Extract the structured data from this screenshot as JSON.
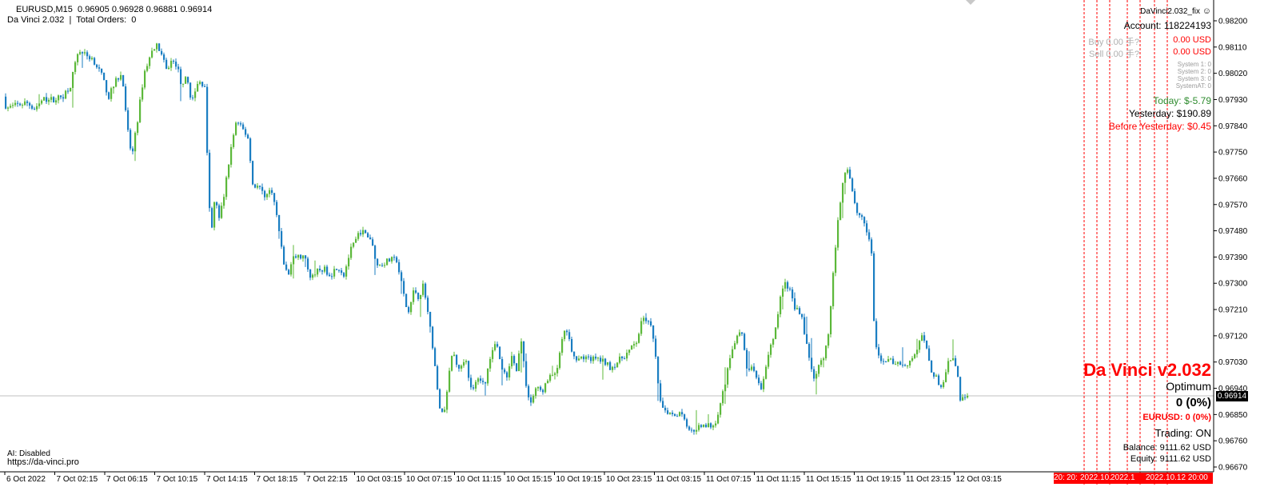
{
  "header": {
    "symbol_line": "EURUSD,M15  0.96905 0.96928 0.96881 0.96914",
    "ea_line": "Da Vinci 2.032  |  Total Orders:  0"
  },
  "footer_left": {
    "ai_status": "AI: Disabled",
    "website": "https://da-vinci.pro"
  },
  "overlay": {
    "ea_file": "DaVinci2.032_fix",
    "account": "Account: 118224193",
    "buy_label": "Buy 0.00 手?",
    "buy_value": "0.00 USD",
    "sell_label": "Sell 0.00 手?",
    "sell_value": "0.00 USD",
    "systems": [
      "System 1: 0",
      "System 2: 0",
      "System 3: 0",
      "SystemAT: 0"
    ],
    "today": "Today: $-5.79",
    "yesterday": "Yesterday: $190.89",
    "before_yesterday": "Before Yesterday: $0.45",
    "brand_title": "Da Vinci v2.032",
    "mode": "Optimum",
    "profit": "0 (0%)",
    "symbol_profit": "EURUSD: 0 (0%)",
    "trading": "Trading: ON",
    "balance": "Balance: 9111.62 USD",
    "equity": "Equity: 9111.62 USD"
  },
  "price_axis": {
    "labels": [
      "0.98200",
      "0.98110",
      "0.98020",
      "0.97930",
      "0.97840",
      "0.97750",
      "0.97660",
      "0.97570",
      "0.97480",
      "0.97390",
      "0.97300",
      "0.97210",
      "0.97120",
      "0.97030",
      "0.96940",
      "0.96850",
      "0.96760",
      "0.96670"
    ],
    "current_price": "0.96914"
  },
  "time_axis": {
    "labels": [
      "6 Oct 2022",
      "7 Oct 02:15",
      "7 Oct 06:15",
      "7 Oct 10:15",
      "7 Oct 14:15",
      "7 Oct 18:15",
      "7 Oct 22:15",
      "10 Oct 03:15",
      "10 Oct 07:15",
      "10 Oct 11:15",
      "10 Oct 15:15",
      "10 Oct 19:15",
      "10 Oct 23:15",
      "11 Oct 03:15",
      "11 Oct 07:15",
      "11 Oct 11:15",
      "11 Oct 15:15",
      "11 Oct 19:15",
      "11 Oct 23:15",
      "12 Oct 03:15"
    ],
    "date_badges": [
      "20:",
      "20:",
      "2022.10.",
      "2022.1",
      "2022.10.12 20:00"
    ]
  },
  "colors": {
    "bull": "#5cb83a",
    "bear": "#1b7ec2",
    "vline": "#ff0000",
    "bid_line": "#c0c0c0",
    "profit_green": "#2e8b2e",
    "loss_red": "#ff0000"
  },
  "chart_data": {
    "type": "candlestick",
    "symbol": "EURUSD",
    "timeframe": "M15",
    "ylim": [
      0.9665,
      0.9825
    ],
    "last": {
      "open": 0.96905,
      "high": 0.96928,
      "low": 0.96881,
      "close": 0.96914
    },
    "path_points": [
      [
        0,
        0.98
      ],
      [
        10,
        0.979
      ],
      [
        22,
        0.9791
      ],
      [
        35,
        0.9792
      ],
      [
        45,
        0.979
      ],
      [
        56,
        0.9793
      ],
      [
        68,
        0.9793
      ],
      [
        80,
        0.9794
      ],
      [
        90,
        0.9798
      ],
      [
        100,
        0.981
      ],
      [
        110,
        0.9808
      ],
      [
        118,
        0.9807
      ],
      [
        128,
        0.9802
      ],
      [
        138,
        0.9794
      ],
      [
        148,
        0.98
      ],
      [
        155,
        0.9802
      ],
      [
        160,
        0.9785
      ],
      [
        167,
        0.9773
      ],
      [
        175,
        0.9788
      ],
      [
        182,
        0.9802
      ],
      [
        190,
        0.9808
      ],
      [
        196,
        0.9812
      ],
      [
        202,
        0.981
      ],
      [
        210,
        0.9803
      ],
      [
        216,
        0.9806
      ],
      [
        223,
        0.9805
      ],
      [
        228,
        0.9799
      ],
      [
        236,
        0.98
      ],
      [
        242,
        0.9792
      ],
      [
        250,
        0.9799
      ],
      [
        258,
        0.9798
      ],
      [
        262,
        0.9766
      ],
      [
        266,
        0.9746
      ],
      [
        271,
        0.976
      ],
      [
        276,
        0.9752
      ],
      [
        282,
        0.976
      ],
      [
        290,
        0.9775
      ],
      [
        297,
        0.9785
      ],
      [
        305,
        0.9783
      ],
      [
        312,
        0.978
      ],
      [
        318,
        0.9764
      ],
      [
        326,
        0.9763
      ],
      [
        334,
        0.976
      ],
      [
        342,
        0.9762
      ],
      [
        350,
        0.975
      ],
      [
        356,
        0.9738
      ],
      [
        362,
        0.9732
      ],
      [
        368,
        0.9739
      ],
      [
        376,
        0.9739
      ],
      [
        382,
        0.9739
      ],
      [
        390,
        0.9733
      ],
      [
        398,
        0.9734
      ],
      [
        406,
        0.9735
      ],
      [
        416,
        0.9733
      ],
      [
        424,
        0.9736
      ],
      [
        432,
        0.9733
      ],
      [
        440,
        0.9741
      ],
      [
        446,
        0.9744
      ],
      [
        452,
        0.9748
      ],
      [
        458,
        0.9747
      ],
      [
        466,
        0.9745
      ],
      [
        474,
        0.9736
      ],
      [
        482,
        0.9737
      ],
      [
        490,
        0.9738
      ],
      [
        498,
        0.9738
      ],
      [
        504,
        0.973
      ],
      [
        512,
        0.9719
      ],
      [
        520,
        0.9728
      ],
      [
        526,
        0.9725
      ],
      [
        532,
        0.973
      ],
      [
        538,
        0.9718
      ],
      [
        544,
        0.9707
      ],
      [
        550,
        0.969
      ],
      [
        556,
        0.9684
      ],
      [
        562,
        0.9695
      ],
      [
        568,
        0.9707
      ],
      [
        576,
        0.97
      ],
      [
        584,
        0.9705
      ],
      [
        592,
        0.9692
      ],
      [
        600,
        0.9698
      ],
      [
        608,
        0.9695
      ],
      [
        616,
        0.9706
      ],
      [
        622,
        0.9711
      ],
      [
        628,
        0.9702
      ],
      [
        636,
        0.9697
      ],
      [
        642,
        0.9705
      ],
      [
        648,
        0.97
      ],
      [
        654,
        0.9711
      ],
      [
        660,
        0.9694
      ],
      [
        666,
        0.9689
      ],
      [
        672,
        0.9694
      ],
      [
        680,
        0.9693
      ],
      [
        688,
        0.9697
      ],
      [
        694,
        0.9699
      ],
      [
        700,
        0.9702
      ],
      [
        706,
        0.9712
      ],
      [
        712,
        0.9714
      ],
      [
        718,
        0.9704
      ],
      [
        726,
        0.9705
      ],
      [
        734,
        0.9704
      ],
      [
        742,
        0.9704
      ],
      [
        750,
        0.9704
      ],
      [
        758,
        0.9703
      ],
      [
        766,
        0.9701
      ],
      [
        774,
        0.9703
      ],
      [
        782,
        0.9705
      ],
      [
        790,
        0.9707
      ],
      [
        798,
        0.971
      ],
      [
        806,
        0.9718
      ],
      [
        814,
        0.9717
      ],
      [
        820,
        0.971
      ],
      [
        826,
        0.9692
      ],
      [
        832,
        0.9687
      ],
      [
        838,
        0.9686
      ],
      [
        846,
        0.9685
      ],
      [
        852,
        0.9686
      ],
      [
        858,
        0.9684
      ],
      [
        864,
        0.9679
      ],
      [
        870,
        0.968
      ],
      [
        876,
        0.9681
      ],
      [
        882,
        0.9682
      ],
      [
        888,
        0.9681
      ],
      [
        896,
        0.9682
      ],
      [
        904,
        0.969
      ],
      [
        912,
        0.97
      ],
      [
        918,
        0.9708
      ],
      [
        924,
        0.9712
      ],
      [
        930,
        0.9713
      ],
      [
        936,
        0.97
      ],
      [
        942,
        0.9702
      ],
      [
        948,
        0.9697
      ],
      [
        954,
        0.9694
      ],
      [
        960,
        0.9702
      ],
      [
        966,
        0.9708
      ],
      [
        972,
        0.9714
      ],
      [
        978,
        0.9725
      ],
      [
        984,
        0.9731
      ],
      [
        990,
        0.9727
      ],
      [
        996,
        0.9722
      ],
      [
        1004,
        0.972
      ],
      [
        1010,
        0.971
      ],
      [
        1016,
        0.9702
      ],
      [
        1020,
        0.9697
      ],
      [
        1026,
        0.9703
      ],
      [
        1032,
        0.9705
      ],
      [
        1038,
        0.9712
      ],
      [
        1044,
        0.9733
      ],
      [
        1050,
        0.9752
      ],
      [
        1056,
        0.9765
      ],
      [
        1062,
        0.977
      ],
      [
        1068,
        0.9762
      ],
      [
        1074,
        0.9754
      ],
      [
        1080,
        0.9753
      ],
      [
        1086,
        0.9748
      ],
      [
        1092,
        0.974
      ],
      [
        1096,
        0.971
      ],
      [
        1102,
        0.9703
      ],
      [
        1110,
        0.9704
      ],
      [
        1118,
        0.9703
      ],
      [
        1126,
        0.9703
      ],
      [
        1134,
        0.9702
      ],
      [
        1142,
        0.9704
      ],
      [
        1150,
        0.9708
      ],
      [
        1156,
        0.9712
      ],
      [
        1162,
        0.9706
      ],
      [
        1168,
        0.9699
      ],
      [
        1174,
        0.9697
      ],
      [
        1180,
        0.9694
      ],
      [
        1186,
        0.9701
      ],
      [
        1192,
        0.9705
      ],
      [
        1198,
        0.9702
      ],
      [
        1203,
        0.969
      ],
      [
        1208,
        0.96914
      ]
    ]
  }
}
